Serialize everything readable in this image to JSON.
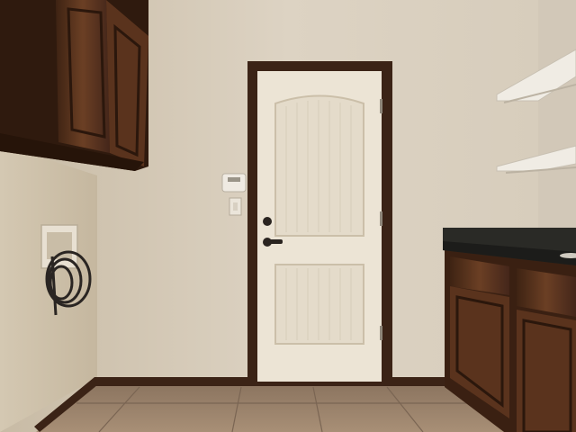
{
  "scene": {
    "subject": "laundry-room-interior",
    "colors": {
      "wall": "#ddd3c3",
      "wall_shadow": "#c9bda9",
      "left_wall": "#cfc3ad",
      "cabinet_wood": "#4a2a17",
      "cabinet_wood_light": "#6b3f24",
      "door": "#ece4d5",
      "door_trim": "#3b2316",
      "baseboard": "#3b2316",
      "floor_tile": "#a88f76",
      "floor_tile_dark": "#8c7560",
      "countertop": "#2a2a26",
      "shelf": "#f0ece4",
      "hose": "#2a2522",
      "thermostat": "#efeae2",
      "switch_plate": "#ebe5da"
    }
  }
}
